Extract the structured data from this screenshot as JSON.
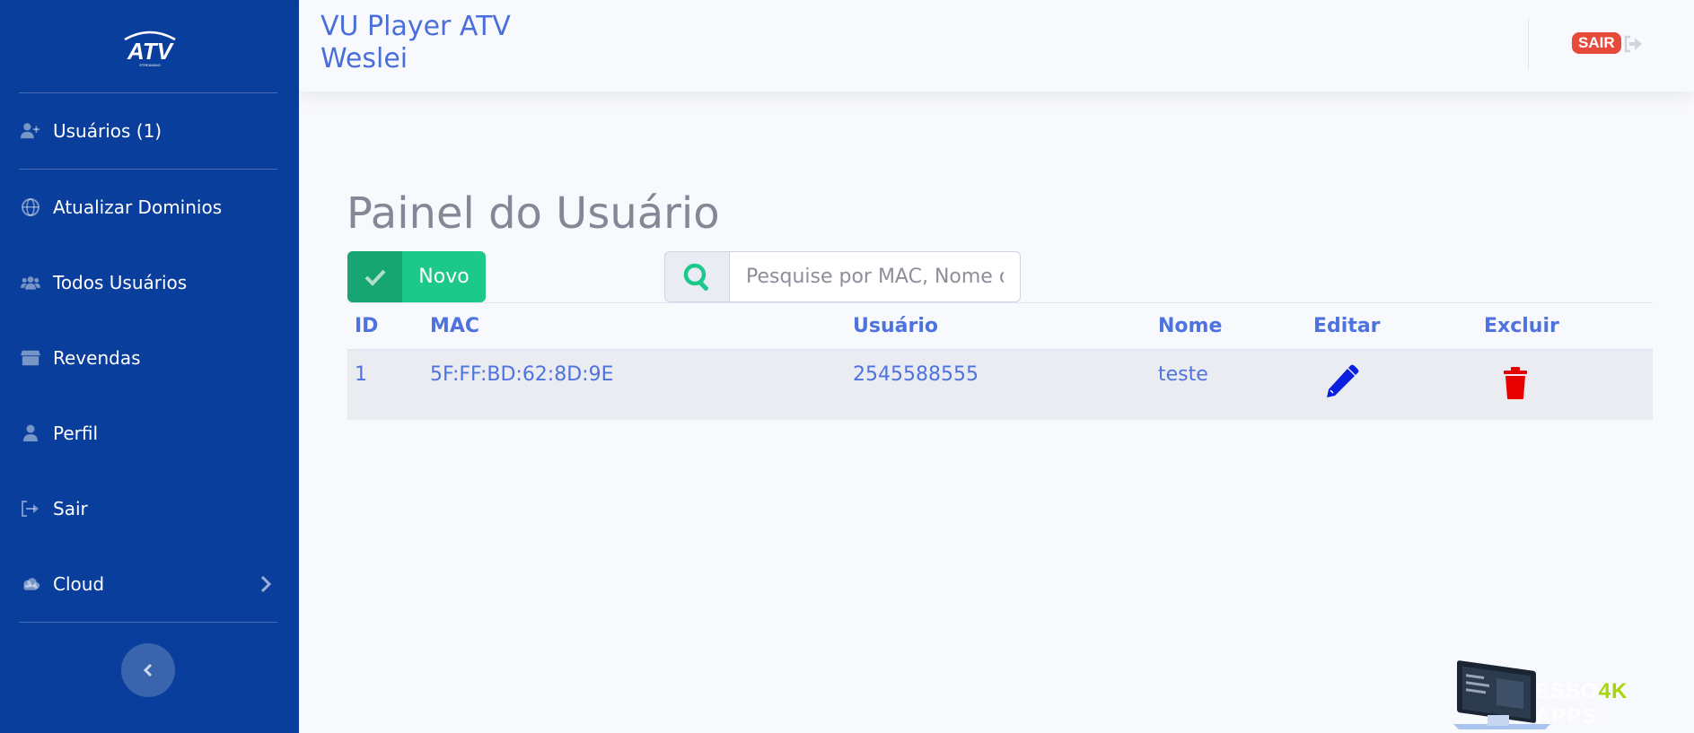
{
  "brand": {
    "logo_text": "ATV",
    "logo_sub": "STREAMING"
  },
  "sidebar": {
    "items": [
      {
        "label": "Usuários (1)",
        "icon": "user-plus-icon"
      },
      {
        "label": "Atualizar Dominios",
        "icon": "globe-icon"
      },
      {
        "label": "Todos Usuários",
        "icon": "users-icon"
      },
      {
        "label": "Revendas",
        "icon": "store-icon"
      },
      {
        "label": "Perfil",
        "icon": "user-icon"
      },
      {
        "label": "Sair",
        "icon": "sign-out-icon"
      },
      {
        "label": "Cloud",
        "icon": "cloud-icon"
      }
    ]
  },
  "header": {
    "title_line1": "VU Player ATV",
    "title_line2": "Weslei",
    "logout_badge": "SAIR"
  },
  "main": {
    "page_title": "Painel do Usuário",
    "new_button": "Novo",
    "search_placeholder": "Pesquise por MAC, Nome ou Usuário",
    "table": {
      "headers": [
        "ID",
        "MAC",
        "Usuário",
        "Nome",
        "Editar",
        "Excluir"
      ],
      "rows": [
        {
          "id": "1",
          "mac": "5F:FF:BD:62:8D:9E",
          "usuario": "2545588555",
          "nome": "teste"
        }
      ]
    }
  },
  "watermark": {
    "part1": "ESSO",
    "part2": "4K",
    "part3": "APPS"
  },
  "colors": {
    "sidebar": "#0a3e9c",
    "accent": "#4e73df",
    "success": "#1cc88a",
    "danger": "#e74a3b"
  }
}
